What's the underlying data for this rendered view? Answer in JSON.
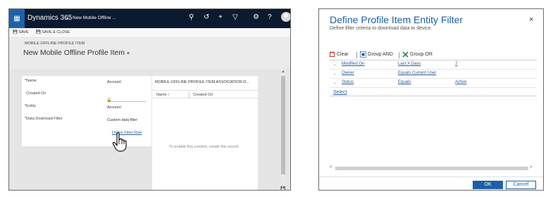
{
  "left": {
    "app_name": "Dynamics 365",
    "record_crumb": "New Mobile Offline ...",
    "topbar_icons": [
      "search-icon",
      "history-icon",
      "plus-icon",
      "filter-icon",
      "gear-icon",
      "help-icon",
      "avatar"
    ],
    "help_glyph": "?",
    "commands": {
      "save": "SAVE",
      "save_close": "SAVE & CLOSE"
    },
    "entity_label": "MOBILE OFFLINE PROFILE ITEM",
    "record_title": "New Mobile Offline Profile Item",
    "form": {
      "name_label": "Name",
      "name_value": "Account",
      "created_on_label": "Created On",
      "entity_label": "Entity",
      "entity_value": "Account",
      "filter_label": "Data Download Filter",
      "filter_value": "Custom data filter",
      "rule_link": "Define Filter Rule"
    },
    "grid": {
      "title": "MOBILE OFFLINE PROFILE ITEM ASSOCIATION D...",
      "col_name": "Name ↑",
      "col_created": "Created On",
      "empty_text": "To enable this content, create the record."
    }
  },
  "dialog": {
    "title": "Define Profile Item Entity Filter",
    "subtitle": "Define filter criteria to download data to device.",
    "close_glyph": "×",
    "toolbar": {
      "clear": "Clear",
      "group_and": "Group AND",
      "group_or": "Group OR"
    },
    "criteria": [
      {
        "field": "Modified On",
        "operator": "Last X Days",
        "value": "7"
      },
      {
        "field": "Owner",
        "operator": "Equals Current User",
        "value": ""
      },
      {
        "field": "Status",
        "operator": "Equals",
        "value": "Active"
      }
    ],
    "select_label": "Select",
    "ok_label": "OK",
    "cancel_label": "Cancel",
    "colors": {
      "accent": "#1f5fa7",
      "link": "#2e5e97",
      "topbar": "#0b1a2e",
      "waffle": "#1d63a8"
    }
  }
}
